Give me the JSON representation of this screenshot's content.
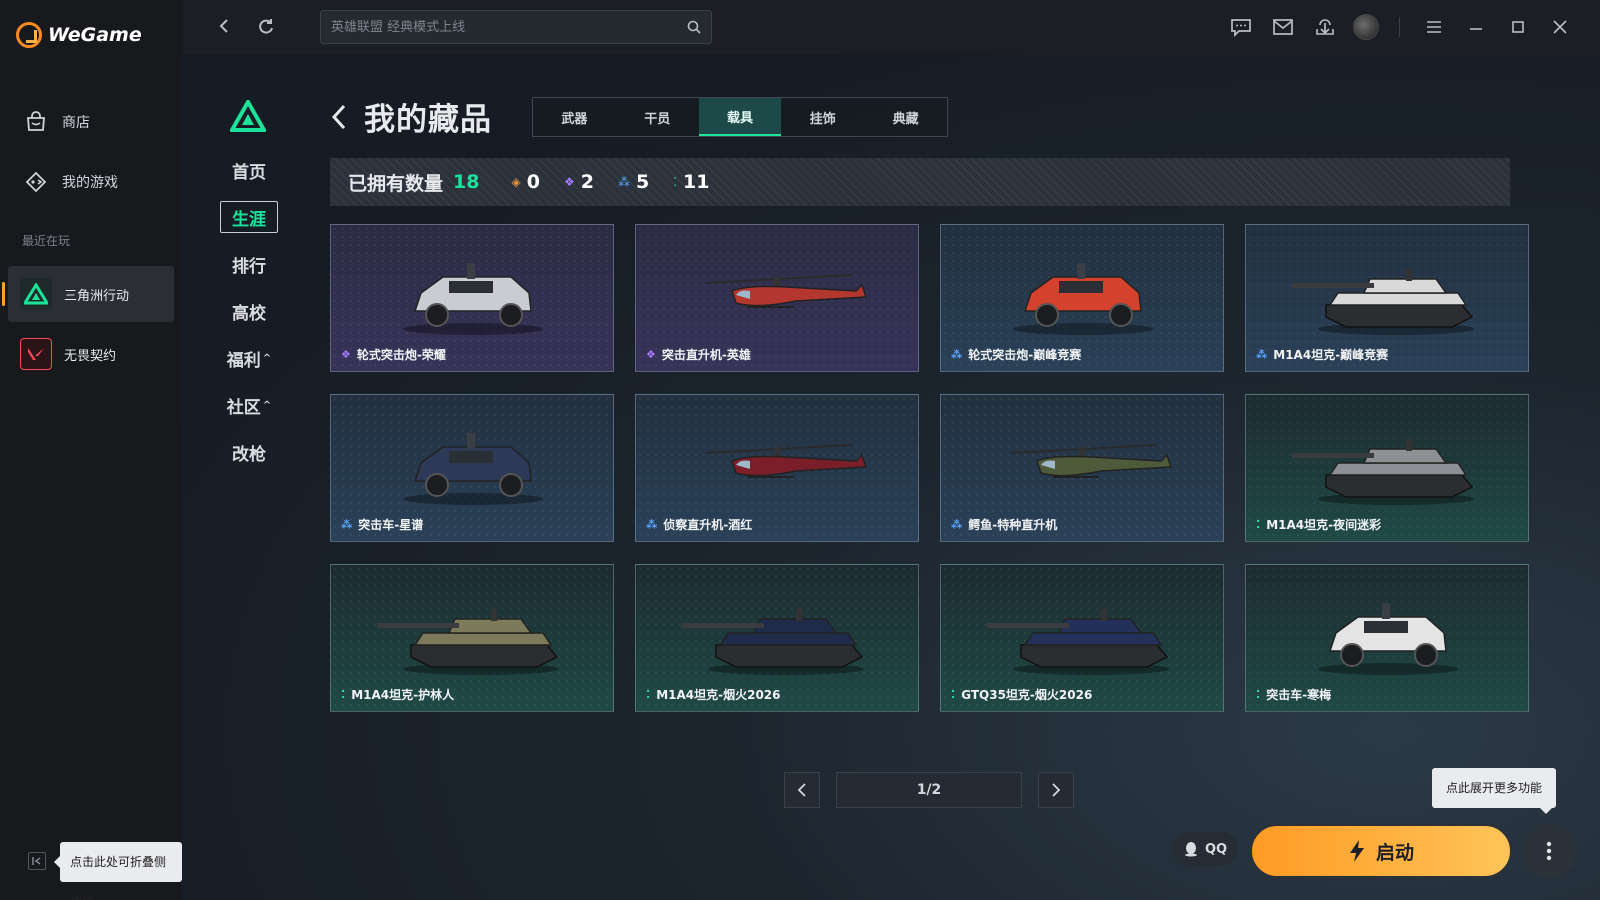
{
  "app": {
    "name": "WeGame"
  },
  "sidebar": {
    "nav": [
      {
        "label": "商店",
        "icon": "store-bag-icon"
      },
      {
        "label": "我的游戏",
        "icon": "gamepad-icon"
      }
    ],
    "recent_title": "最近在玩",
    "games": [
      {
        "label": "三角洲行动",
        "icon": "delta-force-icon",
        "active": true
      },
      {
        "label": "无畏契约",
        "icon": "valorant-icon",
        "active": false
      }
    ],
    "collapse_tip": "点击此处可折叠侧边栏"
  },
  "topbar": {
    "search_placeholder": "英雄联盟 经典模式上线"
  },
  "game_nav": {
    "items": [
      {
        "label": "首页",
        "active": false,
        "caret": ""
      },
      {
        "label": "生涯",
        "active": true,
        "caret": ""
      },
      {
        "label": "排行",
        "active": false,
        "caret": ""
      },
      {
        "label": "高校",
        "active": false,
        "caret": ""
      },
      {
        "label": "福利",
        "active": false,
        "caret": "^"
      },
      {
        "label": "社区",
        "active": false,
        "caret": "^"
      },
      {
        "label": "改枪",
        "active": false,
        "caret": ""
      }
    ]
  },
  "page": {
    "title": "我的藏品",
    "tabs": [
      {
        "label": "武器",
        "active": false
      },
      {
        "label": "干员",
        "active": false
      },
      {
        "label": "载具",
        "active": true
      },
      {
        "label": "挂饰",
        "active": false
      },
      {
        "label": "典藏",
        "active": false
      }
    ],
    "owned_label": "已拥有数量",
    "owned_total": "18",
    "rarity_counts": [
      {
        "color": "#e8923a",
        "count": "0"
      },
      {
        "color": "#a77cff",
        "count": "2"
      },
      {
        "color": "#5aa8ff",
        "count": "5"
      },
      {
        "color": "#2fe0a0",
        "count": "11"
      }
    ]
  },
  "items": [
    {
      "name": "轮式突击炮-荣耀",
      "rarity": "purple",
      "gem_color": "#a77cff",
      "kind": "car",
      "tint": "#c9ccd3"
    },
    {
      "name": "突击直升机-英雄",
      "rarity": "purple",
      "gem_color": "#a77cff",
      "kind": "heli",
      "tint": "#b3362f"
    },
    {
      "name": "轮式突击炮-巅峰竞赛",
      "rarity": "blue",
      "gem_color": "#5aa8ff",
      "kind": "car",
      "tint": "#d4412c"
    },
    {
      "name": "M1A4坦克-巅峰竞赛",
      "rarity": "blue",
      "gem_color": "#5aa8ff",
      "kind": "tank",
      "tint": "#d9d9d9"
    },
    {
      "name": "突击车-星谱",
      "rarity": "blue",
      "gem_color": "#5aa8ff",
      "kind": "car",
      "tint": "#2d3a57"
    },
    {
      "name": "侦察直升机-酒红",
      "rarity": "blue",
      "gem_color": "#5aa8ff",
      "kind": "heli",
      "tint": "#7a1e2a"
    },
    {
      "name": "鳄鱼-特种直升机",
      "rarity": "blue",
      "gem_color": "#5aa8ff",
      "kind": "heli",
      "tint": "#4e5b3a"
    },
    {
      "name": "M1A4坦克-夜间迷彩",
      "rarity": "green",
      "gem_color": "#2fe0a0",
      "kind": "tank",
      "tint": "#8d9095"
    },
    {
      "name": "M1A4坦克-护林人",
      "rarity": "green",
      "gem_color": "#2fe0a0",
      "kind": "tank",
      "tint": "#7c7a5a"
    },
    {
      "name": "M1A4坦克-烟火2026",
      "rarity": "green",
      "gem_color": "#2fe0a0",
      "kind": "tank",
      "tint": "#1f2b4a"
    },
    {
      "name": "GTQ35坦克-烟火2026",
      "rarity": "green",
      "gem_color": "#2fe0a0",
      "kind": "tank",
      "tint": "#22305a"
    },
    {
      "name": "突击车-寒梅",
      "rarity": "green",
      "gem_color": "#2fe0a0",
      "kind": "car",
      "tint": "#e4e4e4"
    }
  ],
  "pager": {
    "current": "1/2"
  },
  "actions": {
    "more_tip": "点此展开更多功能",
    "qq_label": "QQ",
    "launch_label": "启动"
  }
}
